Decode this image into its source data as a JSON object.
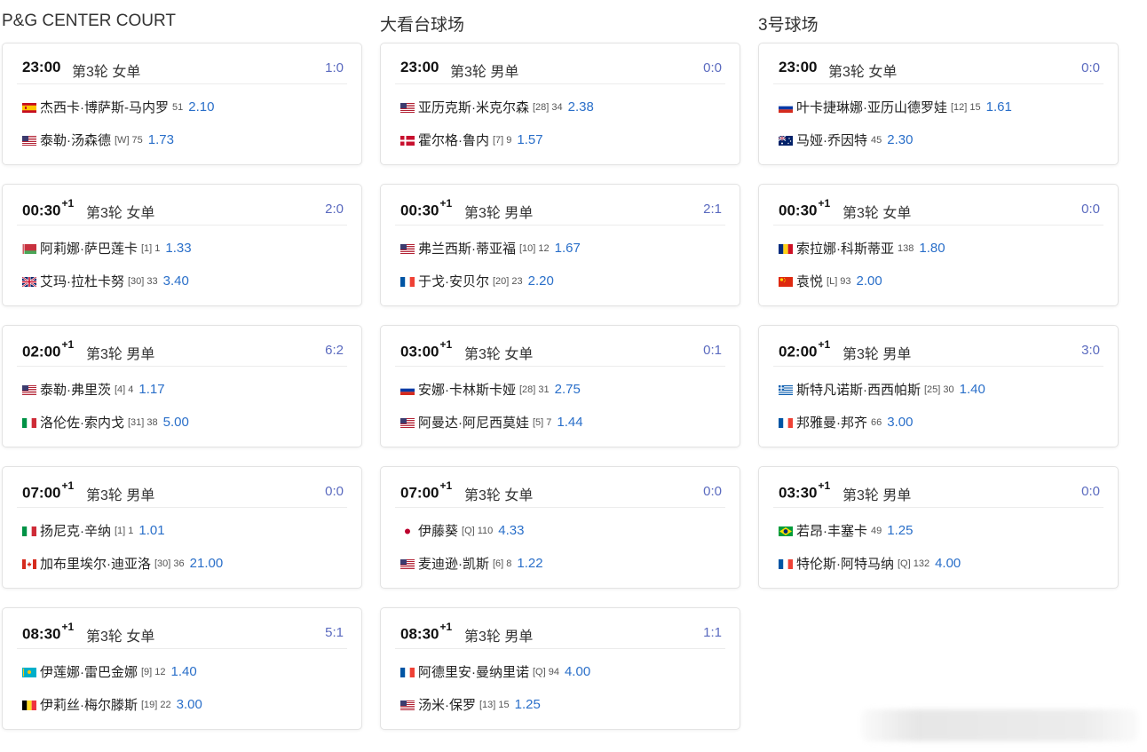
{
  "courts": [
    {
      "name": "P&G CENTER COURT",
      "matches": [
        {
          "time": "23:00",
          "next_day": "",
          "round": "第3轮 女单",
          "score": "1:0",
          "p1": {
            "flag": "ES",
            "name": "杰西卡·博萨斯-马内罗",
            "seed": "51",
            "odds": "2.10"
          },
          "p2": {
            "flag": "US",
            "name": "泰勒·汤森德",
            "seed": "[W] 75",
            "odds": "1.73"
          }
        },
        {
          "time": "00:30",
          "next_day": "+1",
          "round": "第3轮 女单",
          "score": "2:0",
          "p1": {
            "flag": "BY",
            "name": "阿莉娜·萨巴莲卡",
            "seed": "[1] 1",
            "odds": "1.33"
          },
          "p2": {
            "flag": "GB",
            "name": "艾玛·拉杜卡努",
            "seed": "[30] 33",
            "odds": "3.40"
          }
        },
        {
          "time": "02:00",
          "next_day": "+1",
          "round": "第3轮 男单",
          "score": "6:2",
          "p1": {
            "flag": "US",
            "name": "泰勒·弗里茨",
            "seed": "[4] 4",
            "odds": "1.17"
          },
          "p2": {
            "flag": "IT",
            "name": "洛伦佐·索内戈",
            "seed": "[31] 38",
            "odds": "5.00"
          }
        },
        {
          "time": "07:00",
          "next_day": "+1",
          "round": "第3轮 男单",
          "score": "0:0",
          "p1": {
            "flag": "IT",
            "name": "扬尼克·辛纳",
            "seed": "[1] 1",
            "odds": "1.01"
          },
          "p2": {
            "flag": "CA",
            "name": "加布里埃尔·迪亚洛",
            "seed": "[30] 36",
            "odds": "21.00"
          }
        },
        {
          "time": "08:30",
          "next_day": "+1",
          "round": "第3轮 女单",
          "score": "5:1",
          "p1": {
            "flag": "KZ",
            "name": "伊莲娜·雷巴金娜",
            "seed": "[9] 12",
            "odds": "1.40"
          },
          "p2": {
            "flag": "BE",
            "name": "伊莉丝·梅尔滕斯",
            "seed": "[19] 22",
            "odds": "3.00"
          }
        }
      ]
    },
    {
      "name": "大看台球场",
      "matches": [
        {
          "time": "23:00",
          "next_day": "",
          "round": "第3轮 男单",
          "score": "0:0",
          "p1": {
            "flag": "US",
            "name": "亚历克斯·米克尔森",
            "seed": "[28] 34",
            "odds": "2.38"
          },
          "p2": {
            "flag": "DK",
            "name": "霍尔格·鲁内",
            "seed": "[7] 9",
            "odds": "1.57"
          }
        },
        {
          "time": "00:30",
          "next_day": "+1",
          "round": "第3轮 男单",
          "score": "2:1",
          "p1": {
            "flag": "US",
            "name": "弗兰西斯·蒂亚福",
            "seed": "[10] 12",
            "odds": "1.67"
          },
          "p2": {
            "flag": "FR",
            "name": "于戈·安贝尔",
            "seed": "[20] 23",
            "odds": "2.20"
          }
        },
        {
          "time": "03:00",
          "next_day": "+1",
          "round": "第3轮 女单",
          "score": "0:1",
          "p1": {
            "flag": "RU",
            "name": "安娜·卡林斯卡娅",
            "seed": "[28] 31",
            "odds": "2.75"
          },
          "p2": {
            "flag": "US",
            "name": "阿曼达·阿尼西莫娃",
            "seed": "[5] 7",
            "odds": "1.44"
          }
        },
        {
          "time": "07:00",
          "next_day": "+1",
          "round": "第3轮 女单",
          "score": "0:0",
          "p1": {
            "flag": "JP",
            "name": "伊藤葵",
            "seed": "[Q] 110",
            "odds": "4.33"
          },
          "p2": {
            "flag": "US",
            "name": "麦迪逊·凯斯",
            "seed": "[6] 8",
            "odds": "1.22"
          }
        },
        {
          "time": "08:30",
          "next_day": "+1",
          "round": "第3轮 男单",
          "score": "1:1",
          "p1": {
            "flag": "FR",
            "name": "阿德里安·曼纳里诺",
            "seed": "[Q] 94",
            "odds": "4.00"
          },
          "p2": {
            "flag": "US",
            "name": "汤米·保罗",
            "seed": "[13] 15",
            "odds": "1.25"
          }
        }
      ]
    },
    {
      "name": "3号球场",
      "matches": [
        {
          "time": "23:00",
          "next_day": "",
          "round": "第3轮 女单",
          "score": "0:0",
          "p1": {
            "flag": "RU",
            "name": "叶卡捷琳娜·亚历山德罗娃",
            "seed": "[12] 15",
            "odds": "1.61"
          },
          "p2": {
            "flag": "AU",
            "name": "马娅·乔因特",
            "seed": "45",
            "odds": "2.30"
          }
        },
        {
          "time": "00:30",
          "next_day": "+1",
          "round": "第3轮 女单",
          "score": "0:0",
          "p1": {
            "flag": "RO",
            "name": "索拉娜·科斯蒂亚",
            "seed": "138",
            "odds": "1.80"
          },
          "p2": {
            "flag": "CN",
            "name": "袁悦",
            "seed": "[L] 93",
            "odds": "2.00"
          }
        },
        {
          "time": "02:00",
          "next_day": "+1",
          "round": "第3轮 男单",
          "score": "3:0",
          "p1": {
            "flag": "GR",
            "name": "斯特凡诺斯·西西帕斯",
            "seed": "[25] 30",
            "odds": "1.40"
          },
          "p2": {
            "flag": "FR",
            "name": "邦雅曼·邦齐",
            "seed": "66",
            "odds": "3.00"
          }
        },
        {
          "time": "03:30",
          "next_day": "+1",
          "round": "第3轮 男单",
          "score": "0:0",
          "p1": {
            "flag": "BR",
            "name": "若昂·丰塞卡",
            "seed": "49",
            "odds": "1.25"
          },
          "p2": {
            "flag": "FR",
            "name": "特伦斯·阿特马纳",
            "seed": "[Q] 132",
            "odds": "4.00"
          }
        }
      ]
    }
  ]
}
